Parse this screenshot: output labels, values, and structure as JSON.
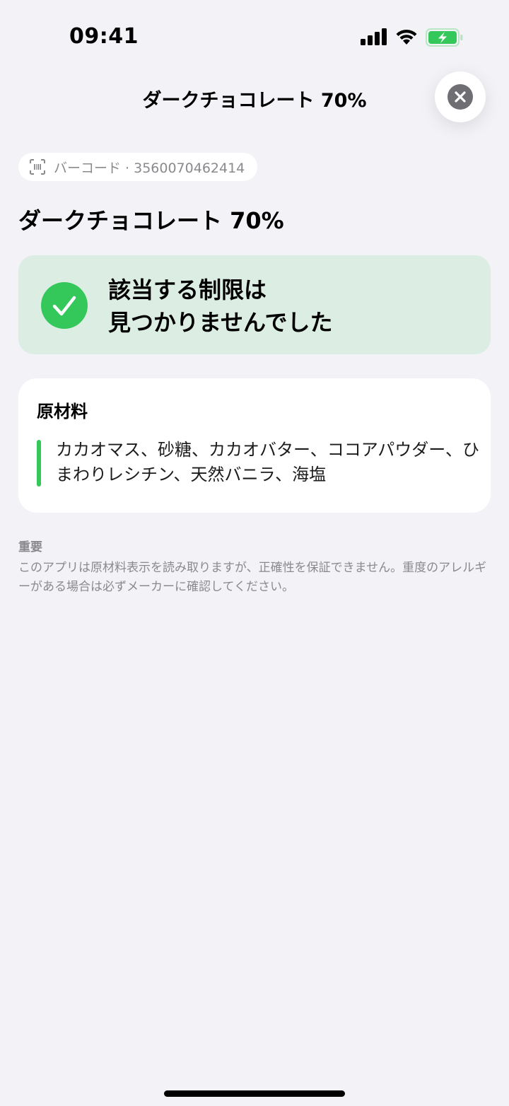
{
  "status_bar": {
    "time": "09:41",
    "icons": [
      "cellular-signal-icon",
      "wifi-icon",
      "battery-charging-icon"
    ],
    "battery_color": "#34c759"
  },
  "nav": {
    "title": "ダークチョコレート 70%",
    "close_icon": "close-icon"
  },
  "barcode": {
    "icon": "barcode-scan-icon",
    "text": "バーコード · 3560070462414"
  },
  "product": {
    "name": "ダークチョコレート 70%"
  },
  "result": {
    "icon": "checkmark-circle-icon",
    "color": "#34c759",
    "background": "#dcede3",
    "message": "該当する制限は\n見つかりませんでした"
  },
  "ingredients": {
    "title": "原材料",
    "accent_color": "#34c759",
    "text": "カカオマス、砂糖、カカオバター、ココアパウダー、ひまわりレシチン、天然バニラ、海塩"
  },
  "note": {
    "heading": "重要",
    "body": "このアプリは原材料表示を読み取りますが、正確性を保証できません。重度のアレルギーがある場合は必ずメーカーに確認してください。"
  }
}
